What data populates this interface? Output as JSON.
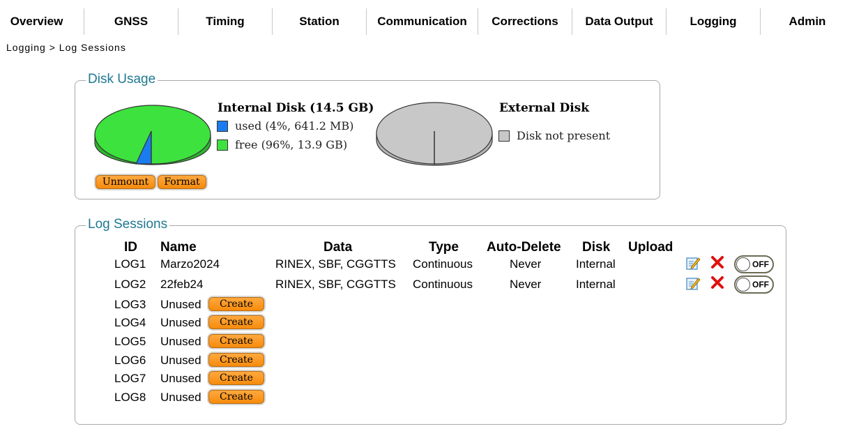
{
  "nav": {
    "items": [
      "Overview",
      "GNSS",
      "Timing",
      "Station",
      "Communication",
      "Corrections",
      "Data Output",
      "Logging",
      "Admin"
    ]
  },
  "breadcrumb": "Logging > Log Sessions",
  "disk_usage": {
    "legend": "Disk Usage",
    "internal": {
      "title": "Internal Disk (14.5 GB)",
      "used_label": "used (4%, 641.2 MB)",
      "free_label": "free (96%, 13.9 GB)",
      "used_fraction": 0.04,
      "used_color": "#1b7cf0",
      "free_color": "#3ee23e"
    },
    "external": {
      "title": "External Disk",
      "status_label": "Disk not present",
      "color": "#c8c8c8"
    },
    "buttons": {
      "unmount": "Unmount",
      "format": "Format"
    }
  },
  "log_sessions": {
    "legend": "Log Sessions",
    "headers": {
      "id": "ID",
      "name": "Name",
      "data": "Data",
      "type": "Type",
      "auto_delete": "Auto-Delete",
      "disk": "Disk",
      "upload": "Upload"
    },
    "active_rows": [
      {
        "id": "LOG1",
        "name": "Marzo2024",
        "data": "RINEX, SBF, CGGTTS",
        "type": "Continuous",
        "auto_delete": "Never",
        "disk": "Internal",
        "upload": "",
        "toggle": "OFF"
      },
      {
        "id": "LOG2",
        "name": "22feb24",
        "data": "RINEX, SBF, CGGTTS",
        "type": "Continuous",
        "auto_delete": "Never",
        "disk": "Internal",
        "upload": "",
        "toggle": "OFF"
      }
    ],
    "unused_rows": [
      {
        "id": "LOG3",
        "name": "Unused",
        "button": "Create"
      },
      {
        "id": "LOG4",
        "name": "Unused",
        "button": "Create"
      },
      {
        "id": "LOG5",
        "name": "Unused",
        "button": "Create"
      },
      {
        "id": "LOG6",
        "name": "Unused",
        "button": "Create"
      },
      {
        "id": "LOG7",
        "name": "Unused",
        "button": "Create"
      },
      {
        "id": "LOG8",
        "name": "Unused",
        "button": "Create"
      }
    ],
    "icons": {
      "edit": "edit-icon",
      "delete": "delete-icon"
    }
  },
  "colors": {
    "legend_text": "#1f7891",
    "button_orange": "#f68b0c",
    "delete_red": "#e01010"
  }
}
